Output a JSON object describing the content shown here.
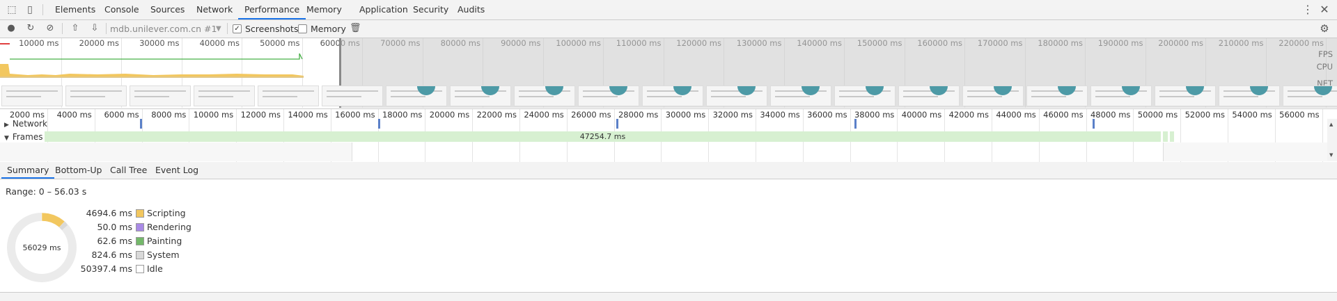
{
  "tabs": [
    {
      "label": "Elements"
    },
    {
      "label": "Console"
    },
    {
      "label": "Sources"
    },
    {
      "label": "Network"
    },
    {
      "label": "Performance",
      "active": true
    },
    {
      "label": "Memory"
    },
    {
      "label": "Application"
    },
    {
      "label": "Security"
    },
    {
      "label": "Audits"
    }
  ],
  "toolbar": {
    "profile_select": "mdb.unilever.com.cn #1",
    "screenshots_label": "Screenshots",
    "screenshots_checked": true,
    "memory_label": "Memory",
    "memory_checked": false
  },
  "overview": {
    "ticks": [
      "10000 ms",
      "20000 ms",
      "30000 ms",
      "40000 ms",
      "50000 ms",
      "60000 ms",
      "70000 ms",
      "80000 ms",
      "90000 ms",
      "100000 ms",
      "110000 ms",
      "120000 ms",
      "130000 ms",
      "140000 ms",
      "150000 ms",
      "160000 ms",
      "170000 ms",
      "180000 ms",
      "190000 ms",
      "200000 ms",
      "210000 ms",
      "220000 ms"
    ],
    "row_labels": {
      "fps": "FPS",
      "cpu": "CPU",
      "net": "NET"
    }
  },
  "timeline": {
    "ticks": [
      "2000 ms",
      "4000 ms",
      "6000 ms",
      "8000 ms",
      "10000 ms",
      "12000 ms",
      "14000 ms",
      "16000 ms",
      "18000 ms",
      "20000 ms",
      "22000 ms",
      "24000 ms",
      "26000 ms",
      "28000 ms",
      "30000 ms",
      "32000 ms",
      "34000 ms",
      "36000 ms",
      "38000 ms",
      "40000 ms",
      "42000 ms",
      "44000 ms",
      "46000 ms",
      "48000 ms",
      "50000 ms",
      "52000 ms",
      "54000 ms",
      "56000 ms"
    ],
    "network_label": "Network",
    "frames_label": "Frames",
    "frame_duration": "47254.7 ms"
  },
  "bottom_tabs": [
    {
      "label": "Summary",
      "active": true
    },
    {
      "label": "Bottom-Up"
    },
    {
      "label": "Call Tree"
    },
    {
      "label": "Event Log"
    }
  ],
  "summary": {
    "range": "Range: 0 – 56.03 s",
    "total": "56029 ms",
    "items": [
      {
        "value": "4694.6 ms",
        "name": "Scripting",
        "color": "#f2c75f"
      },
      {
        "value": "50.0 ms",
        "name": "Rendering",
        "color": "#a98ae6"
      },
      {
        "value": "62.6 ms",
        "name": "Painting",
        "color": "#74b86a"
      },
      {
        "value": "824.6 ms",
        "name": "System",
        "color": "#d9d9d9"
      },
      {
        "value": "50397.4 ms",
        "name": "Idle",
        "color": "#ffffff"
      }
    ]
  }
}
